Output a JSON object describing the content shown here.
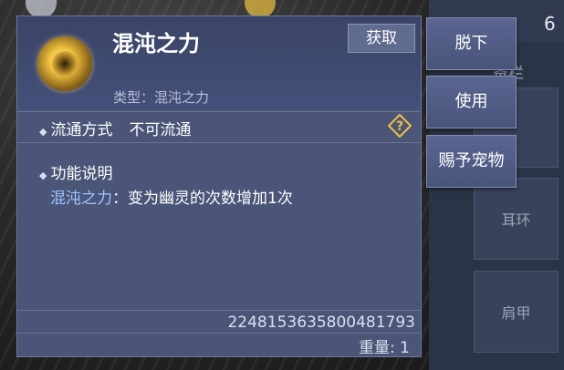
{
  "item": {
    "name": "混沌之力",
    "obtain_label": "获取",
    "type_label": "类型：",
    "type_value": "混沌之力",
    "circulation_label": "流通方式",
    "circulation_value": "不可流通",
    "function_title": "功能说明",
    "function_highlight": "混沌之力",
    "function_text": "：变为幽灵的次数增加1次",
    "item_id": "2248153635800481793",
    "weight": "重量: 1",
    "icon": "gold-chaos-orb-icon"
  },
  "actions": [
    {
      "label": "脱下"
    },
    {
      "label": "使用"
    },
    {
      "label": "赐予宠物"
    }
  ],
  "equipment": {
    "title_fragment": "备栏",
    "count_fragment": "6",
    "slot_partial": "",
    "slots": [
      {
        "label": "耳环"
      },
      {
        "label": "肩甲"
      }
    ]
  },
  "colors": {
    "panel_bg": "#4a5577",
    "highlight_text": "#9fc4ff",
    "help_icon": "#f0c23e"
  }
}
